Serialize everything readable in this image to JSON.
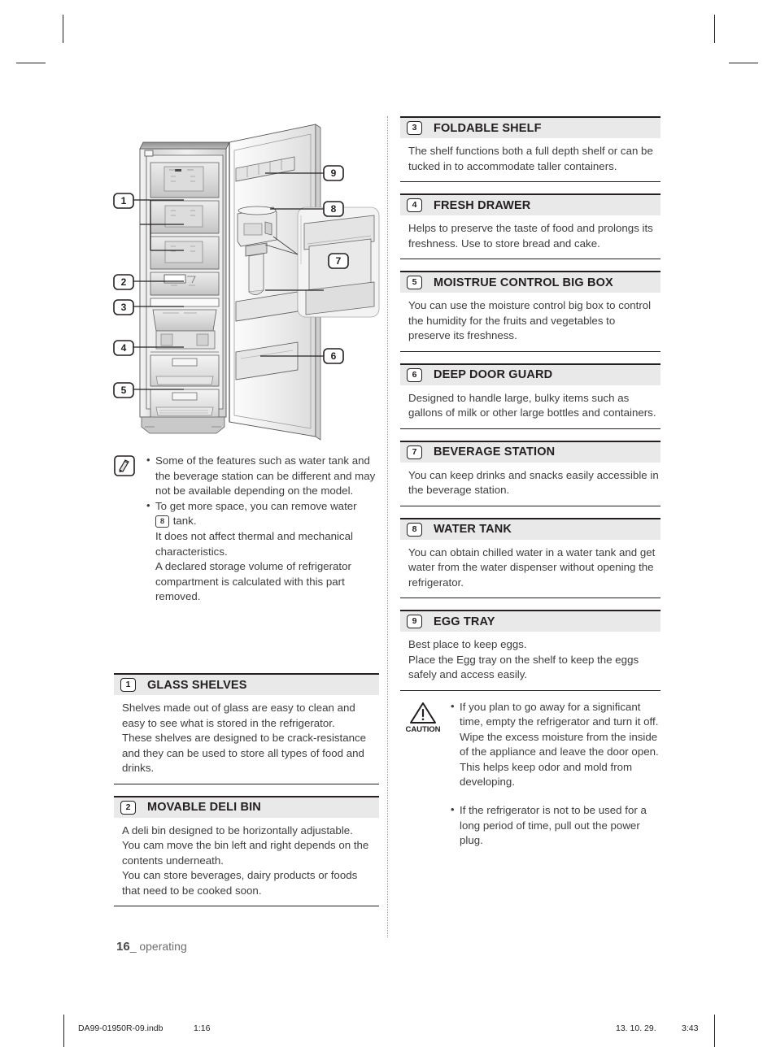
{
  "page": {
    "footer_page_number": "16",
    "footer_section": "_ operating"
  },
  "print_footer": {
    "file": "DA99-01950R-09.indb",
    "page_ref": "1:16",
    "date": "13. 10. 29.",
    "time": "3:43"
  },
  "diagram": {
    "title": "refrigerator-interior-diagram",
    "callouts": [
      "1",
      "2",
      "3",
      "4",
      "5",
      "6",
      "7",
      "8",
      "9"
    ]
  },
  "note": {
    "icon_name": "note-pencil-icon",
    "items": [
      "Some of the features such as water tank and the beverage station can be different and may not be available depending on the model.",
      "To get more space, you can remove water",
      "It does not affect thermal and mechanical characteristics.",
      "A declared storage volume of refrigerator compartment is calculated with this part removed."
    ],
    "inline_number": "8",
    "inline_after": " tank."
  },
  "caution": {
    "label": "CAUTION",
    "items": [
      "If you plan to go away for a significant time, empty the refrigerator and turn it off. Wipe the excess moisture from the inside of the appliance and leave the door open. This helps keep odor and mold from developing.",
      "If the refrigerator is not to be used for a long period of time, pull out the power plug."
    ]
  },
  "left_sections": [
    {
      "number": "1",
      "title": "GLASS SHELVES",
      "body": "Shelves made out of glass are easy to clean and easy to see what is stored in the refrigerator.\nThese shelves are designed to be crack-resistance and they can be used to store all types of food and drinks."
    },
    {
      "number": "2",
      "title": "MOVABLE DELI BIN",
      "body": "A deli bin designed to be horizontally adjustable.\nYou cam move the bin left and right depends on the contents underneath.\nYou can store beverages, dairy products or foods that need to be cooked soon."
    }
  ],
  "right_sections": [
    {
      "number": "3",
      "title": "FOLDABLE SHELF",
      "body": "The shelf functions both a full depth shelf or can be tucked in to accommodate taller containers."
    },
    {
      "number": "4",
      "title": "FRESH DRAWER",
      "body": "Helps to preserve the taste of food and prolongs its freshness. Use to store bread and cake."
    },
    {
      "number": "5",
      "title": "MOISTRUE CONTROL BIG BOX",
      "body": "You can use the moisture control big box to control the humidity for the fruits and vegetables to preserve its freshness."
    },
    {
      "number": "6",
      "title": "DEEP DOOR GUARD",
      "body": "Designed to handle large, bulky items such as gallons of milk or other large bottles and containers."
    },
    {
      "number": "7",
      "title": "BEVERAGE STATION",
      "body": "You can keep drinks and snacks easily accessible in the beverage station."
    },
    {
      "number": "8",
      "title": "WATER TANK",
      "body": "You can obtain chilled water in a water tank and get water from the water dispenser without opening the refrigerator."
    },
    {
      "number": "9",
      "title": "EGG TRAY",
      "body": "Best place to keep eggs.\nPlace the Egg tray on the shelf to keep the eggs safely and access easily."
    }
  ],
  "colors": {
    "header_bar": "#e9e9e9",
    "ink": "#231f20",
    "body_text": "#3d3d3d",
    "footer_text": "#6e6e6e"
  }
}
